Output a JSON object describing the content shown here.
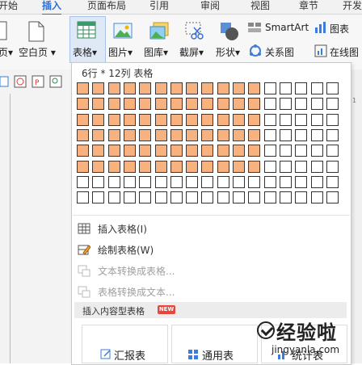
{
  "tabs": [
    {
      "label": "开始"
    },
    {
      "label": "插入",
      "active": true
    },
    {
      "label": "页面布局"
    },
    {
      "label": "引用"
    },
    {
      "label": "审阅"
    },
    {
      "label": "视图"
    },
    {
      "label": "章节"
    },
    {
      "label": "开发"
    }
  ],
  "ribbon": {
    "left_cut": "页▾",
    "blank_page": "空白页",
    "table": "表格",
    "picture": "图片",
    "gallery": "图库",
    "screenshot": "截屏",
    "shape": "形状",
    "relation": "关系图",
    "smartart": "SmartArt",
    "chart": "图表",
    "online": "在线图"
  },
  "dropdown": {
    "title": "6行 * 12列 表格",
    "grid": {
      "rows": 8,
      "cols": 17,
      "selected_rows": 6,
      "selected_cols": 12
    },
    "items": [
      {
        "label": "插入表格(I)",
        "enabled": true,
        "icon": "table-grid-icon"
      },
      {
        "label": "绘制表格(W)",
        "enabled": true,
        "icon": "pencil-table-icon"
      },
      {
        "label": "文本转换成表格...",
        "enabled": false,
        "icon": "text-to-table-icon"
      },
      {
        "label": "表格转换成文本...",
        "enabled": false,
        "icon": "table-to-text-icon"
      }
    ],
    "section": {
      "label": "插入内容型表格",
      "badge": "NEW"
    },
    "cards": [
      {
        "label": "汇报表",
        "icon": "edit-icon"
      },
      {
        "label": "通用表",
        "icon": "grid-icon"
      },
      {
        "label": "统计表",
        "icon": "stats-icon"
      }
    ]
  },
  "watermark": {
    "main": "经验啦",
    "sub": "jingyanla.com"
  },
  "colors": {
    "accent": "#2b6fd6",
    "selected_cell": "#f7b27f"
  }
}
